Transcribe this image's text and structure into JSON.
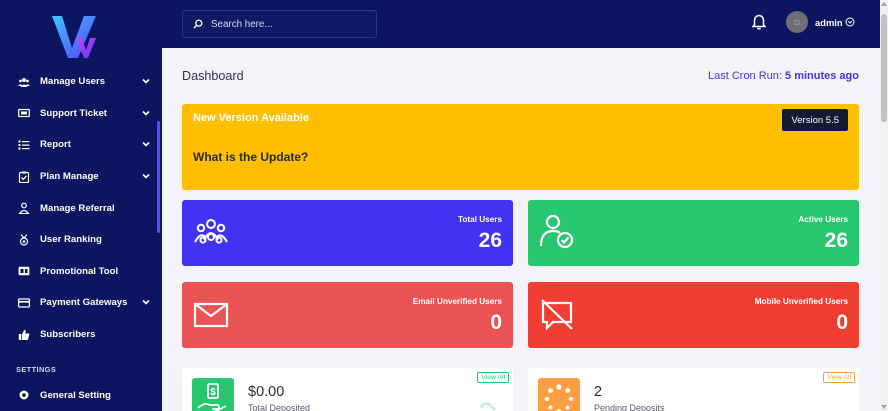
{
  "sidebar": {
    "items": [
      {
        "label": "Manage Users",
        "icon": "users-icon",
        "has_children": true
      },
      {
        "label": "Support Ticket",
        "icon": "ticket-icon",
        "has_children": true
      },
      {
        "label": "Report",
        "icon": "list-icon",
        "has_children": true
      },
      {
        "label": "Plan Manage",
        "icon": "clipboard-check-icon",
        "has_children": true
      },
      {
        "label": "Manage Referral",
        "icon": "user-tie-icon",
        "has_children": false
      },
      {
        "label": "User Ranking",
        "icon": "medal-icon",
        "has_children": false
      },
      {
        "label": "Promotional Tool",
        "icon": "ad-icon",
        "has_children": false
      },
      {
        "label": "Payment Gateways",
        "icon": "credit-card-icon",
        "has_children": true
      },
      {
        "label": "Subscribers",
        "icon": "thumbs-up-icon",
        "has_children": false
      }
    ],
    "settings_heading": "SETTINGS",
    "general_setting": "General Setting"
  },
  "topbar": {
    "search_placeholder": "Search here...",
    "admin_name": "admin"
  },
  "page": {
    "title": "Dashboard",
    "cron_label": "Last Cron Run:",
    "cron_value": "5 minutes ago"
  },
  "banner": {
    "title": "New Version Available",
    "question": "What is the Update?",
    "version": "Version 5.5"
  },
  "stats": [
    {
      "label": "Total Users",
      "value": "26",
      "color": "#4232f2",
      "icon": "users-group-icon"
    },
    {
      "label": "Active Users",
      "value": "26",
      "color": "#28c76f",
      "icon": "user-check-icon"
    },
    {
      "label": "Email Unverified Users",
      "value": "0",
      "color": "#ea5455",
      "icon": "envelope-icon"
    },
    {
      "label": "Mobile Unverified Users",
      "value": "0",
      "color": "#f23d32",
      "icon": "comment-slash-icon"
    }
  ],
  "cards": [
    {
      "amount": "$0.00",
      "sub": "Total Deposited",
      "view_all": "View All",
      "color": "#28c76f",
      "icon": "hand-holding-dollar-icon"
    },
    {
      "amount": "2",
      "sub": "Pending Deposits",
      "view_all": "View All",
      "color": "#ff9f43",
      "icon": "spinner-icon"
    }
  ]
}
